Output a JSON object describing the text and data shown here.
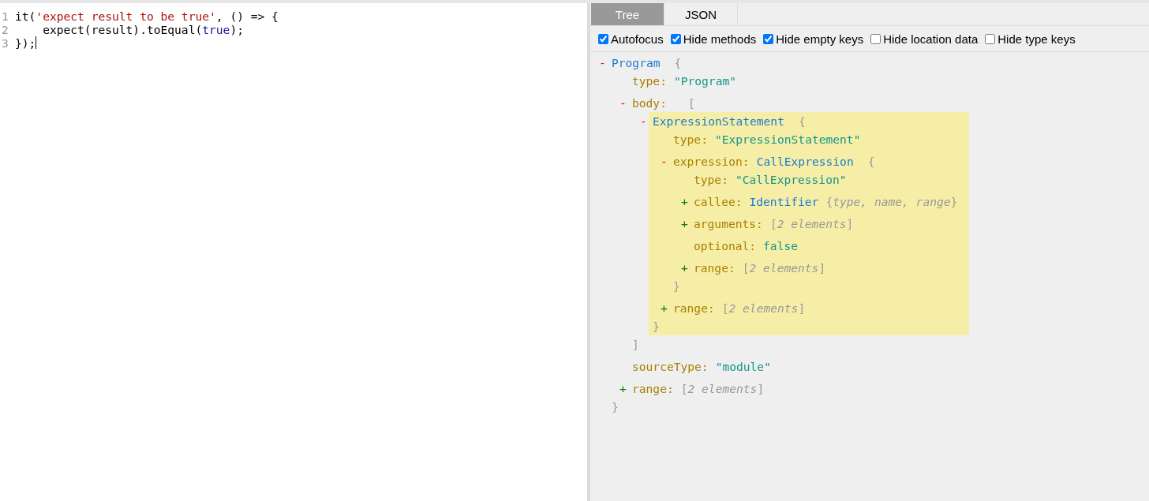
{
  "editor": {
    "lines": [
      {
        "number": "1",
        "cursor": false,
        "tokens": [
          {
            "kind": "plain",
            "text": "it("
          },
          {
            "kind": "string",
            "text": "'expect result to be true'"
          },
          {
            "kind": "plain",
            "text": ", () => {"
          }
        ]
      },
      {
        "number": "2",
        "cursor": false,
        "tokens": [
          {
            "kind": "plain",
            "text": "    expect(result).toEqual("
          },
          {
            "kind": "atom",
            "text": "true"
          },
          {
            "kind": "plain",
            "text": ");"
          }
        ]
      },
      {
        "number": "3",
        "cursor": true,
        "tokens": [
          {
            "kind": "plain",
            "text": "});"
          }
        ]
      }
    ]
  },
  "panel": {
    "tabs": [
      {
        "label": "Tree",
        "selected": true
      },
      {
        "label": "JSON",
        "selected": false
      }
    ],
    "options": [
      {
        "label": "Autofocus",
        "checked": true
      },
      {
        "label": "Hide methods",
        "checked": true
      },
      {
        "label": "Hide empty keys",
        "checked": true
      },
      {
        "label": "Hide location data",
        "checked": false
      },
      {
        "label": "Hide type keys",
        "checked": false
      }
    ],
    "tree": {
      "kind": "node",
      "toggle": "-",
      "expanded": true,
      "highlighted": false,
      "type_name": "Program",
      "open": "{",
      "close": "}",
      "children": [
        {
          "kind": "value",
          "key": "type:",
          "value": "\"Program\""
        },
        {
          "kind": "node",
          "toggle": "-",
          "expanded": true,
          "highlighted": false,
          "key": "body:",
          "open": "[",
          "close": "]",
          "children": [
            {
              "kind": "node",
              "toggle": "-",
              "expanded": true,
              "highlighted": true,
              "type_name": "ExpressionStatement",
              "open": "{",
              "close": "}",
              "children": [
                {
                  "kind": "value",
                  "key": "type:",
                  "value": "\"ExpressionStatement\""
                },
                {
                  "kind": "node",
                  "toggle": "-",
                  "expanded": true,
                  "highlighted": false,
                  "key": "expression:",
                  "type_name": "CallExpression",
                  "open": "{",
                  "close": "}",
                  "children": [
                    {
                      "kind": "value",
                      "key": "type:",
                      "value": "\"CallExpression\""
                    },
                    {
                      "kind": "summary",
                      "toggle": "+",
                      "expanded": false,
                      "key": "callee:",
                      "type_name": "Identifier",
                      "summary": "{*type, name, range*}"
                    },
                    {
                      "kind": "summary",
                      "toggle": "+",
                      "expanded": false,
                      "key": "arguments:",
                      "summary": "[*2 elements*]"
                    },
                    {
                      "kind": "value",
                      "key": "optional:",
                      "value": "false"
                    },
                    {
                      "kind": "summary",
                      "toggle": "+",
                      "expanded": false,
                      "key": "range:",
                      "summary": "[*2 elements*]"
                    }
                  ]
                },
                {
                  "kind": "summary",
                  "toggle": "+",
                  "expanded": false,
                  "key": "range:",
                  "summary": "[*2 elements*]"
                }
              ]
            }
          ]
        },
        {
          "kind": "value",
          "key": "sourceType:",
          "value": "\"module\""
        },
        {
          "kind": "summary",
          "toggle": "+",
          "expanded": false,
          "key": "range:",
          "summary": "[*2 elements*]"
        }
      ]
    }
  }
}
